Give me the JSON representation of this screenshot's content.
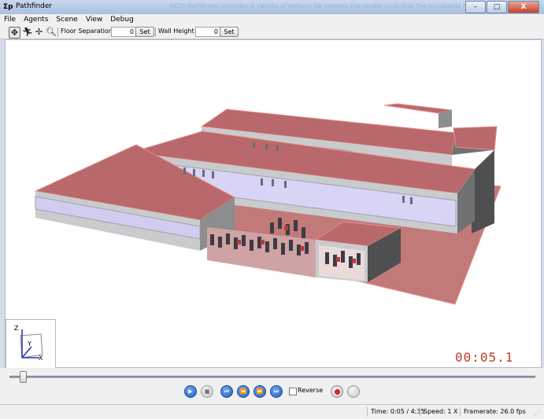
{
  "window": {
    "app_icon_text": "Σp",
    "title": "Pathfinder",
    "faded_caption": "PATH-Pathfinder provides a variety of options for viewing the model such that the occupants mode",
    "minimize": "–",
    "maximize": "□",
    "close": "X"
  },
  "menu": {
    "items": [
      "File",
      "Agents",
      "Scene",
      "View",
      "Debug"
    ]
  },
  "toolbar": {
    "tools": [
      "orbit-tool",
      "agent-tool",
      "pan-tool",
      "zoom-tool"
    ],
    "floor_separation_label": "Floor Separation (m):",
    "floor_separation_value": "0",
    "set_label_1": "Set",
    "wall_height_label": "Wall Height (m):",
    "wall_height_value": "0",
    "set_label_2": "Set"
  },
  "viewport": {
    "axis_z": "Z",
    "axis_y": "Y",
    "axis_x": "X",
    "timer": "00:05.1",
    "colors": {
      "roof": "#b9696b",
      "roof_edge": "#e88d8d",
      "wall": "#c9cbcc",
      "glass": "#c9c5f2",
      "ground": "#c27a79"
    }
  },
  "playback": {
    "progress_fraction": 0.02,
    "reverse_label": "Reverse",
    "reverse_checked": false
  },
  "status": {
    "time": "Time: 0:05 / 4:35",
    "speed": "Speed: 1 X",
    "framerate": "Framerate: 26.0 fps"
  }
}
